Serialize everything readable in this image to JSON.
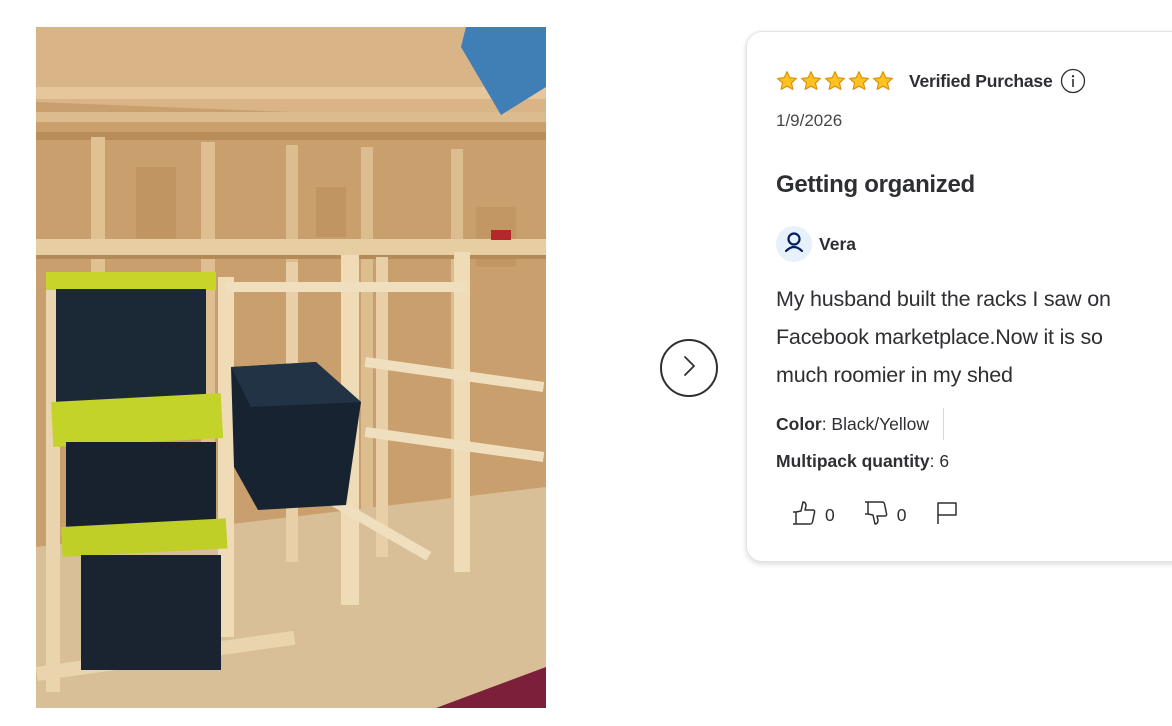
{
  "review": {
    "rating": 5,
    "rating_max": 5,
    "verified_label": "Verified Purchase",
    "date": "1/9/2026",
    "title": "Getting organized",
    "reviewer": "Vera",
    "body": "My husband built the racks I saw on Facebook marketplace.Now it is so much roomier in my shed",
    "attributes": {
      "color_label": "Color",
      "color_value": ": Black/Yellow",
      "qty_label": "Multipack quantity",
      "qty_value": ": 6"
    },
    "helpful_count": "0",
    "unhelpful_count": "0"
  },
  "icons": {
    "star": "star-filled-icon",
    "info": "info-icon",
    "avatar": "user-icon",
    "next": "chevron-right-icon",
    "thumbs_up": "thumbs-up-icon",
    "thumbs_down": "thumbs-down-icon",
    "flag": "flag-icon"
  },
  "colors": {
    "star": "#ffc220",
    "star_outline": "#dc8b00",
    "avatar_bg": "#e6f1fc",
    "avatar_fg": "#001e60",
    "text": "#2e2f32"
  }
}
